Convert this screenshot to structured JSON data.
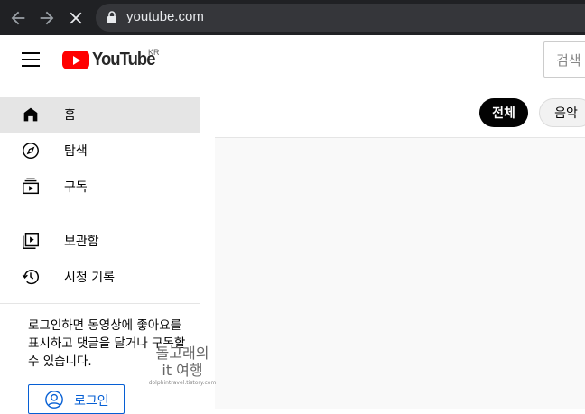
{
  "browser": {
    "url": "youtube.com",
    "back_icon": "arrow-left-icon",
    "forward_icon": "arrow-right-icon",
    "stop_icon": "close-icon"
  },
  "header": {
    "logo_text": "YouTube",
    "region": "KR",
    "search_placeholder": "검색"
  },
  "sidebar": {
    "items": [
      {
        "label": "홈",
        "icon": "home-icon"
      },
      {
        "label": "탐색",
        "icon": "compass-icon"
      },
      {
        "label": "구독",
        "icon": "subscriptions-icon"
      },
      {
        "label": "보관함",
        "icon": "library-icon"
      },
      {
        "label": "시청 기록",
        "icon": "history-icon"
      }
    ],
    "signin_text": "로그인하면 동영상에 좋아요를 표시하고 댓글을 달거나 구독할 수 있습니다.",
    "signin_button": "로그인"
  },
  "chips": [
    "전체",
    "음악"
  ],
  "watermark": {
    "line1": "돌고래의",
    "line2": "it 여행",
    "url": "dolphintravel.tistory.com"
  },
  "colors": {
    "brand_red": "#ff0000",
    "link_blue": "#065fd4",
    "chrome_dark": "#202124"
  }
}
